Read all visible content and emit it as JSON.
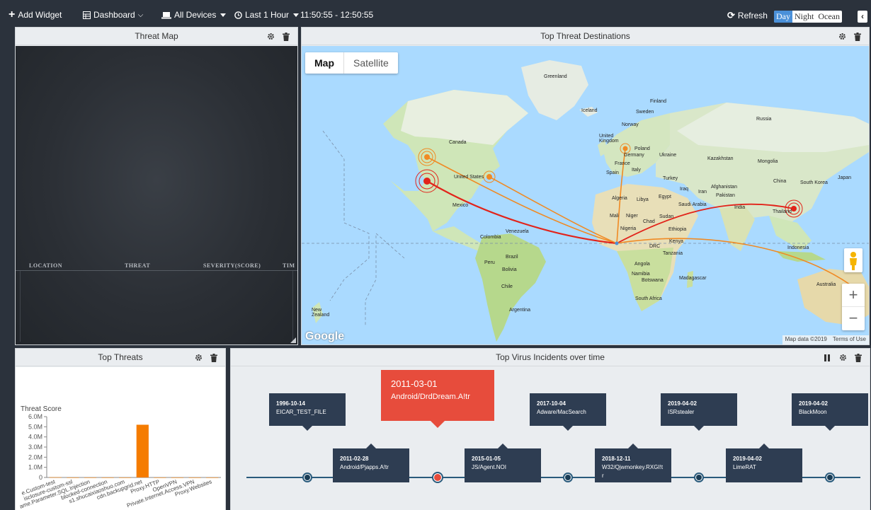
{
  "toolbar": {
    "add_widget": "Add Widget",
    "dashboard": "Dashboard",
    "devices": "All Devices",
    "time_range": "Last 1 Hour",
    "time_span": "11:50:55 - 12:50:55",
    "refresh": "Refresh",
    "themes": [
      "Day",
      "Night",
      "Ocean"
    ],
    "active_theme": "Day",
    "collapse": "‹"
  },
  "threat_map": {
    "title": "Threat Map",
    "columns": [
      "LOCATION",
      "THREAT",
      "SEVERITY(SCORE)",
      "TIM"
    ]
  },
  "destinations": {
    "title": "Top Threat Destinations",
    "map_types": [
      "Map",
      "Satellite"
    ],
    "selected_map_type": "Map",
    "zoom_in": "+",
    "zoom_out": "−",
    "google": "Google",
    "attribution": [
      "Map data ©2019",
      "Terms of Use"
    ],
    "labels": [
      "Greenland",
      "Iceland",
      "Finland",
      "Sweden",
      "Norway",
      "Russia",
      "United Kingdom",
      "Poland",
      "Germany",
      "Ukraine",
      "Kazakhstan",
      "France",
      "Italy",
      "Spain",
      "Turkey",
      "Mongolia",
      "Canada",
      "United States",
      "Mexico",
      "Algeria",
      "Libya",
      "Egypt",
      "Iraq",
      "Iran",
      "Afghanistan",
      "Pakistan",
      "China",
      "Japan",
      "South Korea",
      "Mali",
      "Niger",
      "Chad",
      "Sudan",
      "Saudi Arabia",
      "India",
      "Thailand",
      "Venezuela",
      "Colombia",
      "Nigeria",
      "Ethiopia",
      "Kenya",
      "DRC",
      "Tanzania",
      "Indonesia",
      "Peru",
      "Brazil",
      "Bolivia",
      "Angola",
      "Namibia",
      "Botswana",
      "Madagascar",
      "Chile",
      "South Africa",
      "Australia",
      "Argentina",
      "New Zealand"
    ]
  },
  "top_threats": {
    "title": "Top Threats",
    "chart_data": {
      "type": "bar",
      "title": "Threat Score",
      "ylim": [
        0,
        6000000
      ],
      "yticks": [
        "0",
        "1.0M",
        "2.0M",
        "3.0M",
        "4.0M",
        "5.0M",
        "6.0M"
      ],
      "categories": [
        "e.Custom-test",
        "isclosure-custom-ssl",
        "ame.Parameter.SQL.Injection",
        "blocked-connection",
        "s1.shucaixiaoshuo.com",
        "cdn.backupgrid.net",
        "Proxy.HTTP",
        "OpenVPN",
        "Private.Internet.Access.VPN",
        "Proxy.Websites"
      ],
      "values": [
        20000,
        0,
        0,
        0,
        0,
        5200000,
        0,
        0,
        0,
        0
      ],
      "bar_color": "#f57c00"
    }
  },
  "timeline": {
    "title": "Top Virus Incidents over time",
    "events": [
      {
        "date": "1996-10-14",
        "name": "EICAR_TEST_FILE",
        "pos": "top"
      },
      {
        "date": "2011-02-28",
        "name": "Android/Pjapps.A!tr",
        "pos": "bottom"
      },
      {
        "date": "2011-03-01",
        "name": "Android/DrdDream.A!tr",
        "pos": "top",
        "highlight": true
      },
      {
        "date": "2015-01-05",
        "name": "JS/Agent.NOI",
        "pos": "bottom"
      },
      {
        "date": "2017-10-04",
        "name": "Adware/MacSearch",
        "pos": "top"
      },
      {
        "date": "2018-12-11",
        "name": "W32/Qjwmonkey.RXGI!t r",
        "pos": "bottom"
      },
      {
        "date": "2019-04-02",
        "name": "ISRstealer",
        "pos": "top"
      },
      {
        "date": "2019-04-02",
        "name": "LimeRAT",
        "pos": "bottom"
      },
      {
        "date": "2019-04-02",
        "name": "BlackMoon",
        "pos": "top"
      }
    ],
    "highlight_color": "#e74c3c"
  }
}
